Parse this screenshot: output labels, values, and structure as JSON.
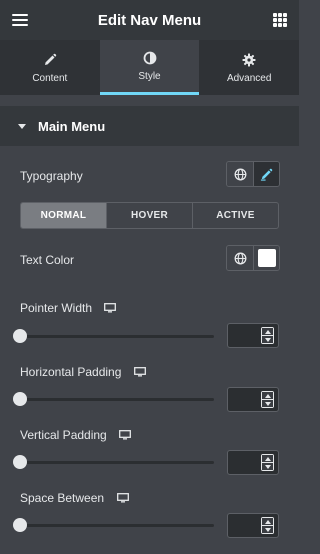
{
  "header": {
    "title": "Edit Nav Menu",
    "left_icon": "hamburger-menu-icon",
    "right_icon": "apps-grid-icon"
  },
  "tabs": [
    {
      "label": "Content",
      "icon": "pencil-icon",
      "active": false
    },
    {
      "label": "Style",
      "icon": "half-circle-icon",
      "active": true
    },
    {
      "label": "Advanced",
      "icon": "gear-icon",
      "active": false
    }
  ],
  "section": {
    "title": "Main Menu",
    "expanded": true
  },
  "typography": {
    "label": "Typography",
    "global_icon": "globe-icon",
    "edit_icon": "pencil-icon"
  },
  "states": [
    "NORMAL",
    "HOVER",
    "ACTIVE"
  ],
  "text_color": {
    "label": "Text Color",
    "global_icon": "globe-icon",
    "swatch_color": "#ffffff"
  },
  "sliders": [
    {
      "label": "Pointer Width",
      "device_icon": "desktop-icon",
      "value": ""
    },
    {
      "label": "Horizontal Padding",
      "device_icon": "desktop-icon",
      "value": ""
    },
    {
      "label": "Vertical Padding",
      "device_icon": "desktop-icon",
      "value": ""
    },
    {
      "label": "Space Between",
      "device_icon": "desktop-icon",
      "value": ""
    }
  ],
  "colors": {
    "accent": "#71d7f7",
    "panel": "#404349",
    "header": "#34383c"
  }
}
